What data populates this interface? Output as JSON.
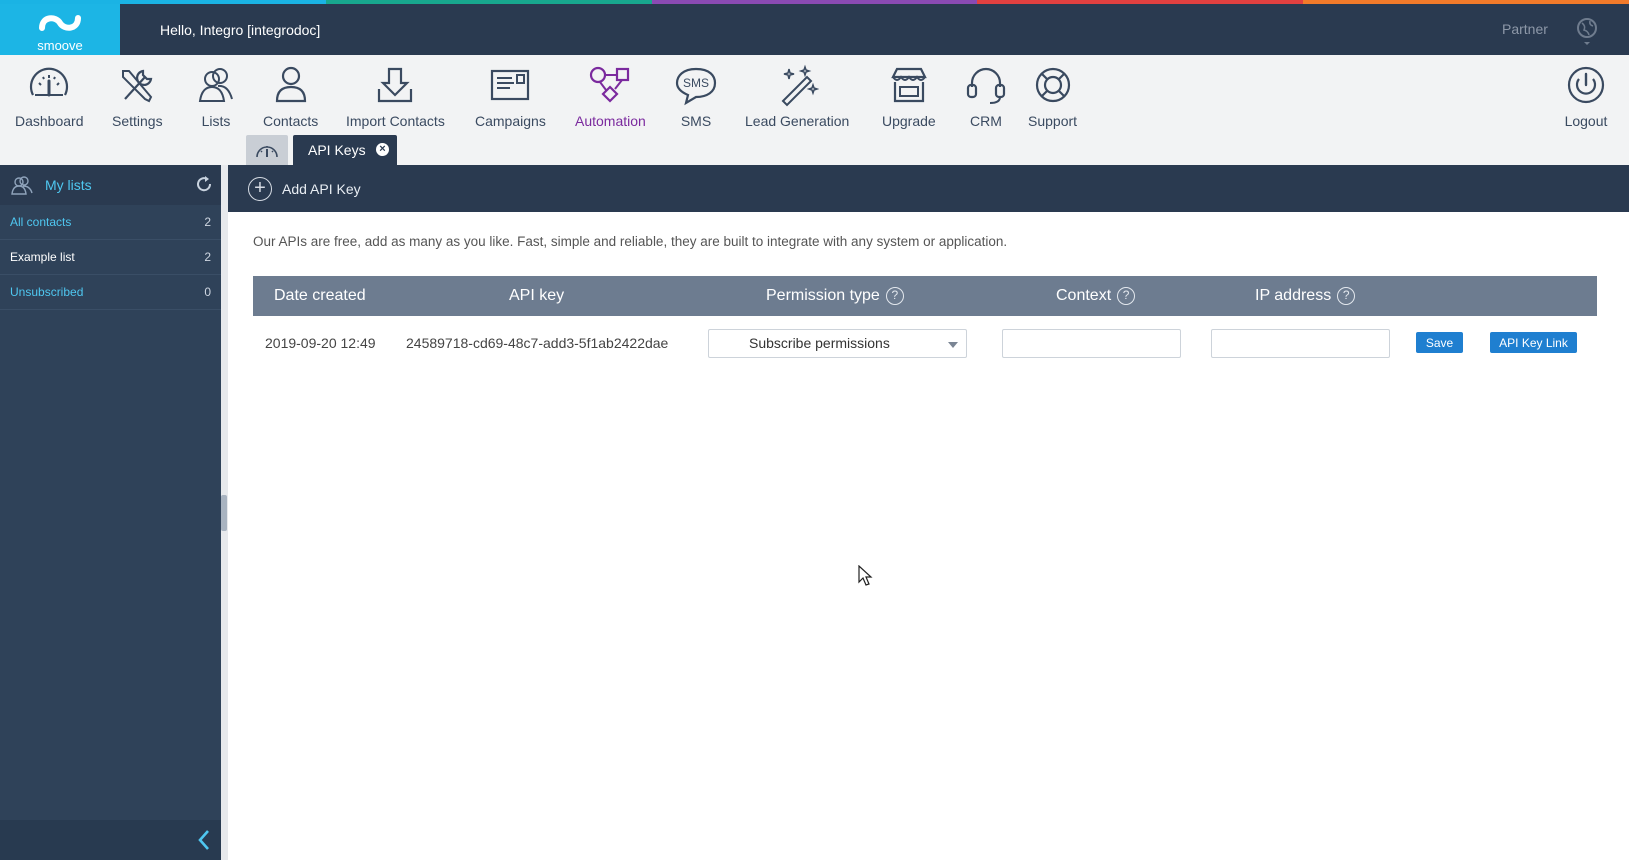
{
  "stripe_colors": [
    "#1ab3e4",
    "#18a78e",
    "#8a4ab3",
    "#e24040",
    "#f27a2a"
  ],
  "header": {
    "logo_text": "smoove",
    "greeting": "Hello, Integro [integrodoc]",
    "partner_label": "Partner",
    "globe_icon": "globe-icon"
  },
  "toolbar": {
    "items": [
      {
        "label": "Dashboard",
        "icon": "speedometer-icon"
      },
      {
        "label": "Settings",
        "icon": "tools-icon"
      },
      {
        "label": "Lists",
        "icon": "people-icon"
      },
      {
        "label": "Contacts",
        "icon": "person-icon"
      },
      {
        "label": "Import Contacts",
        "icon": "import-icon"
      },
      {
        "label": "Campaigns",
        "icon": "envelope-icon"
      },
      {
        "label": "Automation",
        "icon": "flowchart-icon"
      },
      {
        "label": "SMS",
        "icon": "sms-bubble-icon"
      },
      {
        "label": "Lead Generation",
        "icon": "magic-wand-icon"
      },
      {
        "label": "Upgrade",
        "icon": "storefront-icon"
      },
      {
        "label": "CRM",
        "icon": "headset-icon"
      },
      {
        "label": "Support",
        "icon": "lifebuoy-icon"
      }
    ],
    "logout": "Logout"
  },
  "tabs": {
    "active_label": "API Keys",
    "close_glyph": "×"
  },
  "sidebar": {
    "title": "My lists",
    "items": [
      {
        "label": "All contacts",
        "count": "2",
        "color": "#4fc7f0"
      },
      {
        "label": "Example list",
        "count": "2",
        "color": "#ffffff"
      },
      {
        "label": "Unsubscribed",
        "count": "0",
        "color": "#4fc7f0"
      }
    ]
  },
  "actionbar": {
    "add_label": "Add API Key",
    "plus_glyph": "+"
  },
  "content": {
    "description": "Our APIs are free, add as many as you like. Fast, simple and reliable, they are built to integrate with any system or application.",
    "columns": [
      "Date created",
      "API key",
      "Permission type",
      "Context",
      "IP address"
    ],
    "help_glyph": "?",
    "rows": [
      {
        "date_created": "2019-09-20 12:49",
        "api_key": "24589718-cd69-48c7-add3-5f1ab2422dae",
        "permission_type": "Subscribe permissions",
        "context": "",
        "ip_address": "",
        "save_label": "Save",
        "link_label": "API Key Link"
      }
    ]
  },
  "colors": {
    "accent_blue": "#1cb5e5",
    "header_bg": "#2a3a50",
    "button_blue": "#1f7fd0"
  }
}
